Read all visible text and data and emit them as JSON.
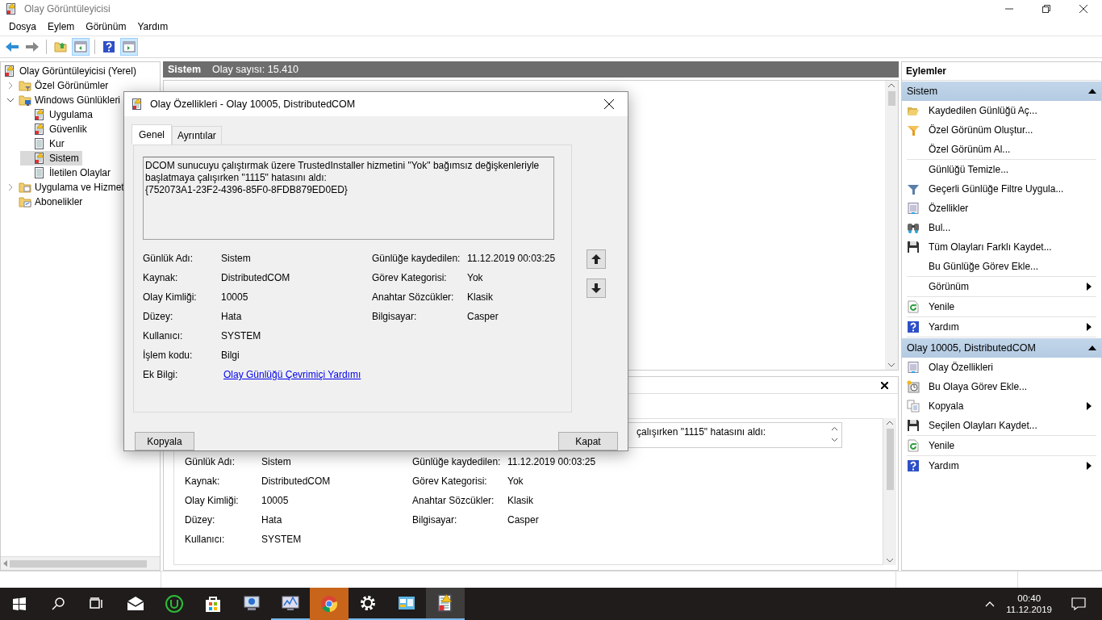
{
  "window": {
    "title": "Olay Görüntüleyicisi"
  },
  "menu": [
    "Dosya",
    "Eylem",
    "Görünüm",
    "Yardım"
  ],
  "toolbar": [
    {
      "pressed": false
    },
    {
      "pressed": false
    },
    {
      "pressed": false
    },
    {
      "pressed": true
    },
    {
      "pressed": false
    },
    {
      "pressed": true
    }
  ],
  "tree": [
    {
      "label": "Olay Görüntüleyicisi (Yerel)",
      "selected": false,
      "children": [
        {
          "label": "Özel Görünümler",
          "expanded": false,
          "selected": false
        },
        {
          "label": "Windows Günlükleri",
          "expanded": true,
          "selected": false,
          "children": [
            {
              "label": "Uygulama",
              "selected": false
            },
            {
              "label": "Güvenlik",
              "selected": false
            },
            {
              "label": "Kur",
              "selected": false
            },
            {
              "label": "Sistem",
              "selected": true
            },
            {
              "label": "İletilen Olaylar",
              "selected": false
            }
          ]
        },
        {
          "label": "Uygulama ve Hizmet",
          "expanded": false,
          "selected": false
        },
        {
          "label": "Abonelikler",
          "selected": false
        }
      ]
    }
  ],
  "log_header": {
    "name": "Sistem",
    "count": "Olay sayısı: 15.410"
  },
  "detail_pane": {
    "description_fragment": "çalışırken \"1115\" hatasını aldı:",
    "left_fields": [
      {
        "label": "Günlük Adı:",
        "value": "Sistem"
      },
      {
        "label": "Kaynak:",
        "value": "DistributedCOM"
      },
      {
        "label": "Olay Kimliği:",
        "value": "10005"
      },
      {
        "label": "Düzey:",
        "value": "Hata"
      },
      {
        "label": "Kullanıcı:",
        "value": "SYSTEM"
      }
    ],
    "right_fields": [
      {
        "label": "Günlüğe kaydedilen:",
        "value": "11.12.2019 00:03:25"
      },
      {
        "label": "Görev Kategorisi:",
        "value": "Yok"
      },
      {
        "label": "Anahtar Sözcükler:",
        "value": "Klasik"
      },
      {
        "label": "Bilgisayar:",
        "value": "Casper"
      }
    ]
  },
  "dialog": {
    "title": "Olay Özellikleri - Olay 10005, DistributedCOM",
    "tabs": [
      {
        "label": "Genel",
        "selected": true
      },
      {
        "label": "Ayrıntılar",
        "selected": false
      }
    ],
    "description": "DCOM sunucuyu çalıştırmak üzere TrustedInstaller hizmetini \"Yok\" bağımsız değişkenleriyle başlatmaya çalışırken \"1115\" hatasını aldı:\n{752073A1-23F2-4396-85F0-8FDB879ED0ED}",
    "left_fields": [
      {
        "label": "Günlük Adı:",
        "value": "Sistem"
      },
      {
        "label": "Kaynak:",
        "value": "DistributedCOM"
      },
      {
        "label": "Olay Kimliği:",
        "value": "10005"
      },
      {
        "label": "Düzey:",
        "value": "Hata"
      },
      {
        "label": "Kullanıcı:",
        "value": "SYSTEM"
      },
      {
        "label": "İşlem kodu:",
        "value": "Bilgi"
      }
    ],
    "right_fields": [
      {
        "label": "Günlüğe kaydedilen:",
        "value": "11.12.2019 00:03:25"
      },
      {
        "label": "Görev Kategorisi:",
        "value": "Yok"
      },
      {
        "label": "Anahtar Sözcükler:",
        "value": "Klasik"
      },
      {
        "label": "Bilgisayar:",
        "value": "Casper"
      }
    ],
    "extra_info": {
      "label": "Ek Bilgi:",
      "link": "Olay Günlüğü Çevrimiçi Yardımı"
    },
    "buttons": [
      "Kopyala",
      "Kapat"
    ]
  },
  "actions": {
    "title": "Eylemler",
    "sections": [
      {
        "title": "Sistem",
        "expanded": true,
        "groups": [
          [
            {
              "label": "Kaydedilen Günlüğü Aç...",
              "submenu": false
            },
            {
              "label": "Özel Görünüm Oluştur...",
              "submenu": false
            },
            {
              "label": "Özel Görünüm Al...",
              "submenu": false
            }
          ],
          [
            {
              "label": "Günlüğü Temizle...",
              "submenu": false
            },
            {
              "label": "Geçerli Günlüğe Filtre Uygula...",
              "submenu": false
            },
            {
              "label": "Özellikler",
              "submenu": false
            },
            {
              "label": "Bul...",
              "submenu": false
            },
            {
              "label": "Tüm Olayları Farklı Kaydet...",
              "submenu": false
            },
            {
              "label": "Bu Günlüğe Görev Ekle...",
              "submenu": false
            }
          ],
          [
            {
              "label": "Görünüm",
              "submenu": true
            }
          ],
          [
            {
              "label": "Yenile",
              "submenu": false
            }
          ],
          [
            {
              "label": "Yardım",
              "submenu": true
            }
          ]
        ]
      },
      {
        "title": "Olay 10005, DistributedCOM",
        "expanded": true,
        "groups": [
          [
            {
              "label": "Olay Özellikleri",
              "submenu": false
            },
            {
              "label": "Bu Olaya Görev Ekle...",
              "submenu": false
            },
            {
              "label": "Kopyala",
              "submenu": true
            },
            {
              "label": "Seçilen Olayları Kaydet...",
              "submenu": false
            }
          ],
          [
            {
              "label": "Yenile",
              "submenu": false
            }
          ],
          [
            {
              "label": "Yardım",
              "submenu": true
            }
          ]
        ]
      }
    ]
  },
  "taskbar": {
    "apps": [
      {
        "running": false,
        "selected": false,
        "attention": false
      },
      {
        "running": false,
        "selected": false,
        "attention": false
      },
      {
        "running": false,
        "selected": false,
        "attention": false
      },
      {
        "running": false,
        "selected": false,
        "attention": false
      },
      {
        "running": true,
        "selected": false,
        "attention": false
      },
      {
        "running": false,
        "selected": false,
        "attention": true
      },
      {
        "running": true,
        "selected": false,
        "attention": false
      },
      {
        "running": true,
        "selected": false,
        "attention": false
      },
      {
        "running": true,
        "selected": true,
        "attention": false
      }
    ],
    "time": "00:40",
    "date": "11.12.2019"
  }
}
